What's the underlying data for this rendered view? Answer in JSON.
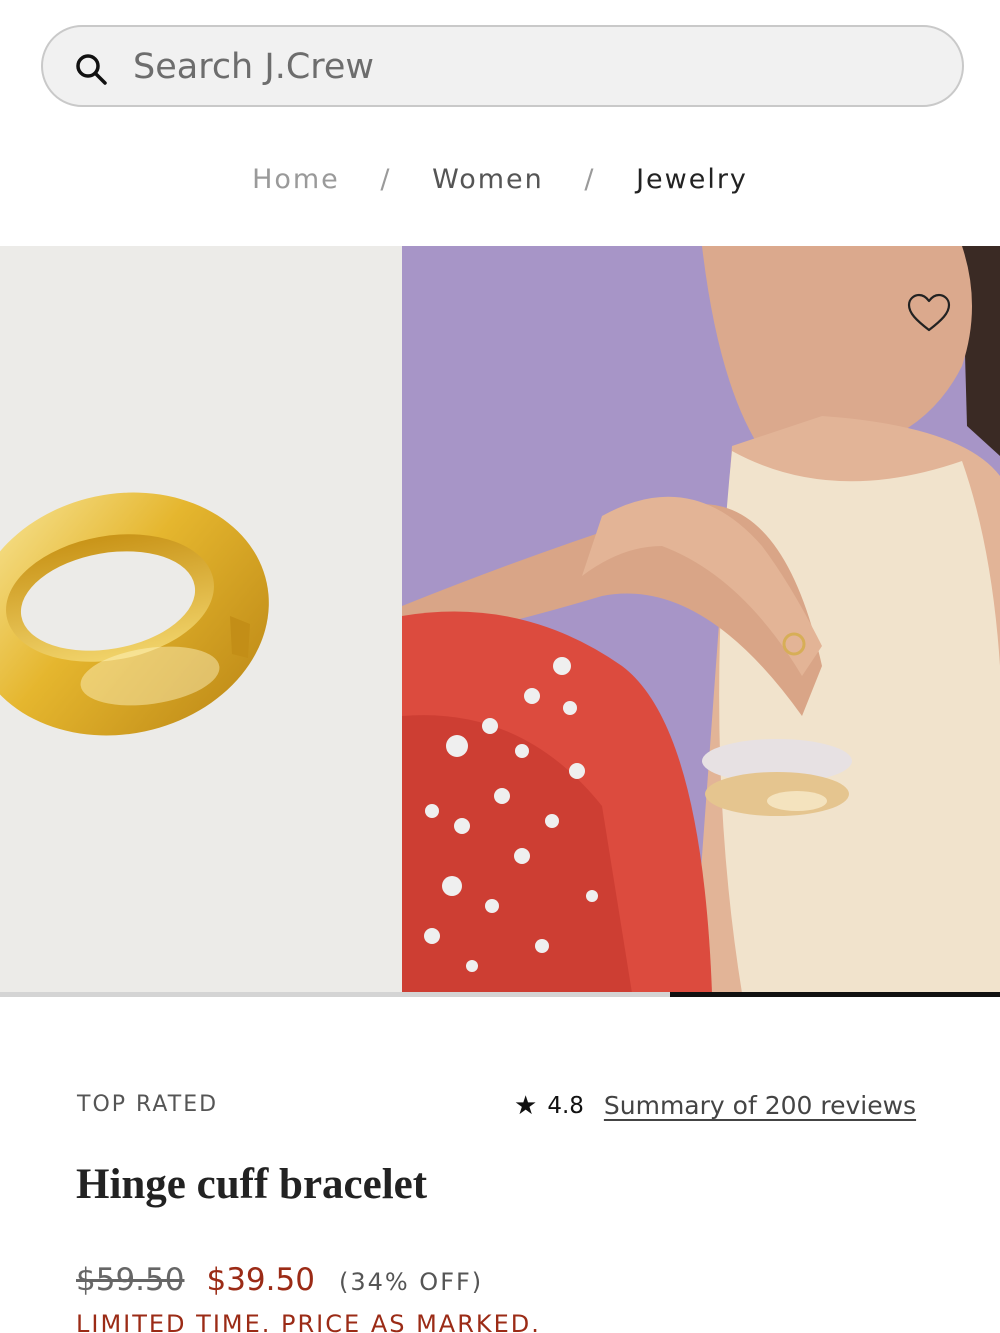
{
  "search": {
    "placeholder": "Search J.Crew",
    "icon": "search-icon"
  },
  "breadcrumb": {
    "items": [
      "Home",
      "Women",
      "Jewelry"
    ],
    "separator": "/"
  },
  "gallery": {
    "images": [
      "gold-hinge-cuff-product-shot",
      "model-wearing-cuff-bracelets"
    ],
    "wishlist_icon": "heart-icon",
    "progress": 0.33
  },
  "product": {
    "badge": "TOP RATED",
    "rating_icon": "star-icon",
    "rating": "4.8",
    "reviews_link": "Summary of 200 reviews",
    "title": "Hinge cuff bracelet",
    "original_price": "$59.50",
    "sale_price": "$39.50",
    "discount": "(34% OFF)",
    "promo": "LIMITED TIME. PRICE AS MARKED."
  },
  "colors": {
    "sale": "#9b2b16",
    "text": "#222222",
    "search_bg": "#f1f1f1",
    "accent_dark": "#111111"
  }
}
